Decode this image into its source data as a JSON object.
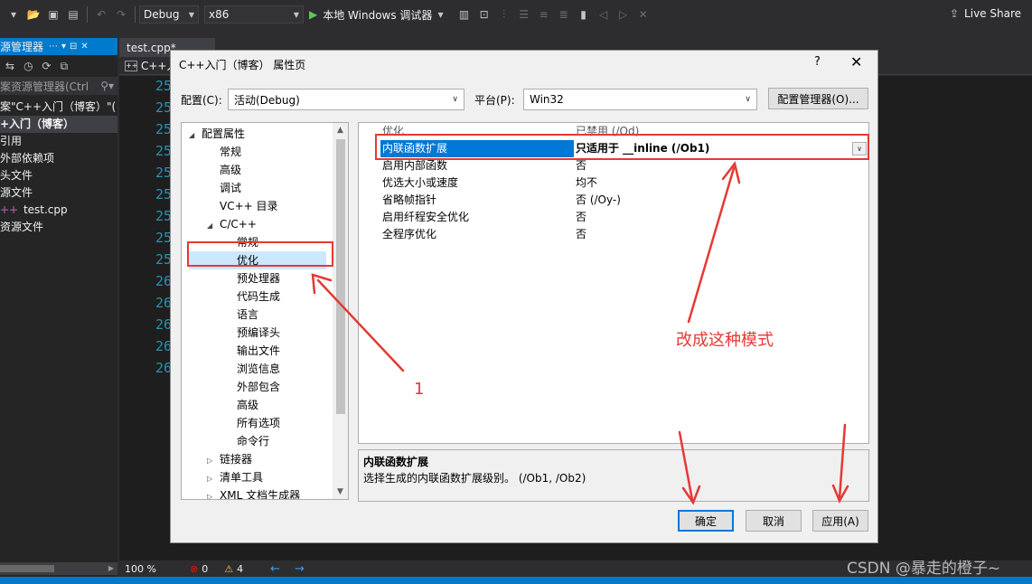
{
  "toolbar": {
    "config": "Debug",
    "platform": "x86",
    "run_label": "本地 Windows 调试器",
    "live_share": "Live Share"
  },
  "solution_explorer": {
    "title": "源管理器",
    "search_placeholder": "案资源管理器(Ctrl",
    "rows": [
      "案\"C++入门（博客）\"(",
      "+入门（博客）",
      "引用",
      "外部依赖项",
      "头文件",
      "源文件",
      "test.cpp",
      "资源文件"
    ]
  },
  "editor": {
    "tab": "test.cpp*",
    "nav": "C++入",
    "line_numbers": [
      "25",
      "25",
      "25",
      "25",
      "25",
      "25",
      "25",
      "25",
      "25",
      "26",
      "26",
      "26",
      "26",
      "26"
    ]
  },
  "statusbar": {
    "zoom": "100 %",
    "errors": "0",
    "warnings": "4"
  },
  "dialog": {
    "title": "C++入门（博客） 属性页",
    "help": "?",
    "close": "✕",
    "config_label": "配置(C):",
    "config_value": "活动(Debug)",
    "platform_label": "平台(P):",
    "platform_value": "Win32",
    "config_manager": "配置管理器(O)...",
    "tree": [
      {
        "label": "配置属性",
        "indent": 0,
        "twisty": "◢"
      },
      {
        "label": "常规",
        "indent": 1,
        "twisty": ""
      },
      {
        "label": "高级",
        "indent": 1,
        "twisty": ""
      },
      {
        "label": "调试",
        "indent": 1,
        "twisty": ""
      },
      {
        "label": "VC++ 目录",
        "indent": 1,
        "twisty": ""
      },
      {
        "label": "C/C++",
        "indent": 1,
        "twisty": "◢"
      },
      {
        "label": "常规",
        "indent": 2,
        "twisty": ""
      },
      {
        "label": "优化",
        "indent": 2,
        "twisty": "",
        "selected": true
      },
      {
        "label": "预处理器",
        "indent": 2,
        "twisty": ""
      },
      {
        "label": "代码生成",
        "indent": 2,
        "twisty": ""
      },
      {
        "label": "语言",
        "indent": 2,
        "twisty": ""
      },
      {
        "label": "预编译头",
        "indent": 2,
        "twisty": ""
      },
      {
        "label": "输出文件",
        "indent": 2,
        "twisty": ""
      },
      {
        "label": "浏览信息",
        "indent": 2,
        "twisty": ""
      },
      {
        "label": "外部包含",
        "indent": 2,
        "twisty": ""
      },
      {
        "label": "高级",
        "indent": 2,
        "twisty": ""
      },
      {
        "label": "所有选项",
        "indent": 2,
        "twisty": ""
      },
      {
        "label": "命令行",
        "indent": 2,
        "twisty": ""
      },
      {
        "label": "链接器",
        "indent": 1,
        "twisty": "▷"
      },
      {
        "label": "清单工具",
        "indent": 1,
        "twisty": "▷"
      },
      {
        "label": "XML 文档生成器",
        "indent": 1,
        "twisty": "▷"
      }
    ],
    "props": [
      {
        "name": "优化",
        "value": "已禁用 (/Od)",
        "gray": true
      },
      {
        "name": "内联函数扩展",
        "value": "只适用于 __inline (/Ob1)",
        "selected": true
      },
      {
        "name": "启用内部函数",
        "value": "否"
      },
      {
        "name": "优选大小或速度",
        "value": "均不"
      },
      {
        "name": "省略帧指针",
        "value": "否 (/Oy-)"
      },
      {
        "name": "启用纤程安全优化",
        "value": "否"
      },
      {
        "name": "全程序优化",
        "value": "否"
      }
    ],
    "desc_title": "内联函数扩展",
    "desc_text": "选择生成的内联函数扩展级别。      (/Ob1, /Ob2)",
    "ok": "确定",
    "cancel": "取消",
    "apply": "应用(A)"
  },
  "annotations": {
    "label_1": "1",
    "label_mode": "改成这种模式",
    "color": "#e53935"
  },
  "watermark": "CSDN @暴走的橙子~"
}
